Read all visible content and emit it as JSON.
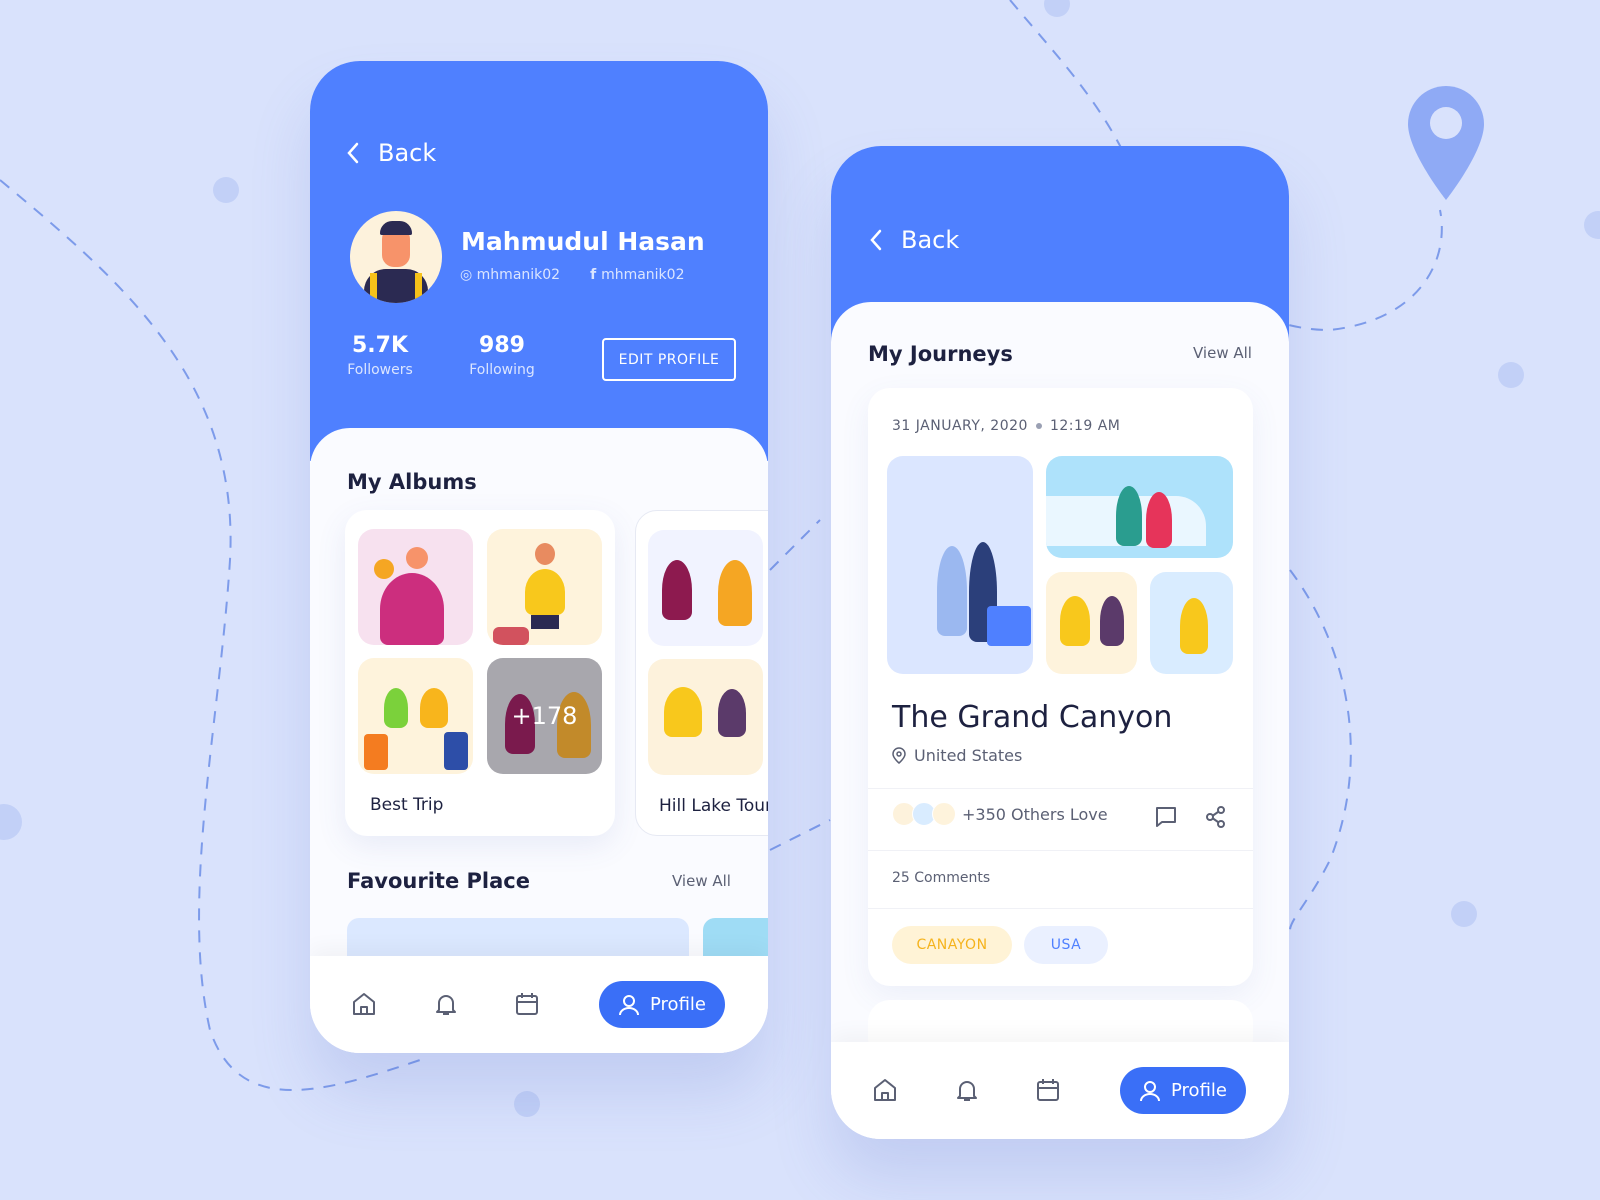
{
  "colors": {
    "background": "#d9e2fc",
    "primary": "#4f80ff",
    "pill": "#3a6ff7",
    "tag_yellow_bg": "#fff3d6",
    "tag_yellow_text": "#f5b31d",
    "tag_blue_bg": "#eaf0ff",
    "tag_blue_text": "#4f80ff"
  },
  "profile_screen": {
    "back_label": "Back",
    "name": "Mahmudul Hasan",
    "instagram": "mhmanik02",
    "facebook": "mhmanik02",
    "stats": [
      {
        "value": "5.7K",
        "label": "Followers"
      },
      {
        "value": "989",
        "label": "Following"
      }
    ],
    "edit_profile_label": "EDIT PROFILE",
    "albums_title": "My Albums",
    "albums": [
      {
        "name": "Best Trip",
        "more_count": "+178"
      },
      {
        "name": "Hill Lake Tour"
      }
    ],
    "favourite_title": "Favourite Place",
    "view_all": "View All",
    "nav": {
      "icons": [
        "home-icon",
        "bell-icon",
        "calendar-icon",
        "user-icon"
      ],
      "active_label": "Profile"
    }
  },
  "journey_screen": {
    "back_label": "Back",
    "title": "My Journeys",
    "view_all": "View All",
    "journey": {
      "date": "31 JANUARY, 2020",
      "time": "12:19 AM",
      "place": "The Grand Canyon",
      "location": "United States",
      "loves": "+350 Others Love",
      "comments": "25 Comments",
      "tags": [
        "CANAYON",
        "USA"
      ]
    },
    "nav": {
      "active_label": "Profile"
    }
  }
}
